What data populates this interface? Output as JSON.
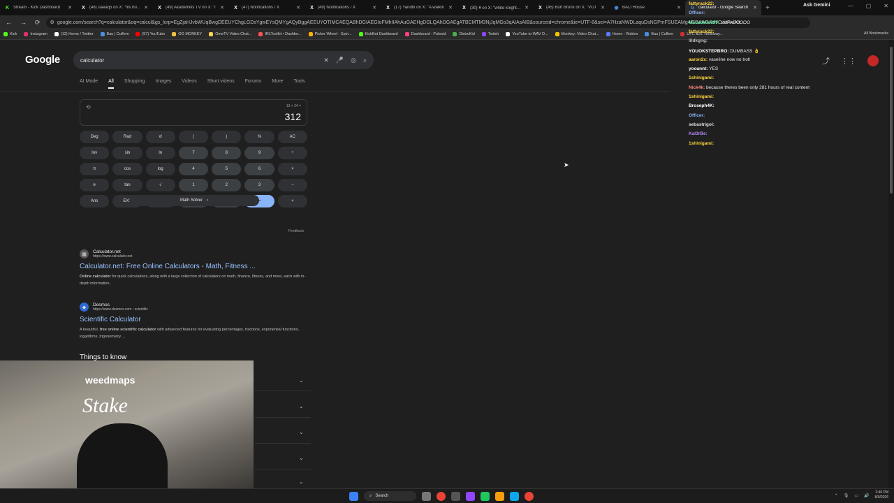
{
  "browser": {
    "tabs": [
      {
        "title": "Stream - Kick Dashboard",
        "color": "#53fc18",
        "icon": "kick-icon",
        "glyph": "K"
      },
      {
        "title": "(48) uaeaq5 on X: \"his burne",
        "color": "#ffffff",
        "icon": "x-icon",
        "glyph": "X"
      },
      {
        "title": "(49) Akademiks TV on X: \"I",
        "color": "#ffffff",
        "icon": "x-icon",
        "glyph": "X"
      },
      {
        "title": "(47) Notifications / X",
        "color": "#ffffff",
        "icon": "x-icon",
        "glyph": "X"
      },
      {
        "title": "(49) Notifications / X",
        "color": "#ffffff",
        "icon": "x-icon",
        "glyph": "X"
      },
      {
        "title": "(17) Yandhi on X: \"A walkin",
        "color": "#ffffff",
        "icon": "x-icon",
        "glyph": "X"
      },
      {
        "title": "(30) ¥ on X: \"white knight 💀",
        "color": "#ffffff",
        "icon": "x-icon",
        "glyph": "X"
      },
      {
        "title": "(45) Burt Bronx on X: \"VOT",
        "color": "#ffffff",
        "icon": "x-icon",
        "glyph": "X"
      },
      {
        "title": "BALI House",
        "color": "#4a90e2",
        "icon": "globe-icon",
        "glyph": "◉"
      },
      {
        "title": "calculator - Google Search",
        "color": "#4285f4",
        "icon": "google-icon",
        "glyph": "G",
        "active": true
      }
    ],
    "ask_gemini": "Ask Gemini",
    "url": "google.com/search?q=calculator&oq=calcul&gs_lcrp=EgZjaHJvbWUqBwgDEEUYChgLGDsYgwEYsQMYgAQyBggAEEUYOTIMCAEQABhDGIAEGIoFMhIIAhAuGAEHgDGLQAhDGAEgATBCMTM3NjJqMGo3qAIAsAIB&sourceid=chrome&ie=UTF-8&sei=A7HzaNWDLaquDsNGPmFSUEAMg4lCBAAGAoYCxixAxiAIt...",
    "bookmarks": [
      {
        "label": "Kick",
        "color": "#53fc18"
      },
      {
        "label": "Instagram",
        "color": "#e1306c"
      },
      {
        "label": "(12) Home / Twitter",
        "color": "#ffffff"
      },
      {
        "label": "Bau | Cuffem",
        "color": "#4a90e2"
      },
      {
        "label": "(57) YouTube",
        "color": "#ff0000"
      },
      {
        "label": "OG MONKEY",
        "color": "#f0c040"
      },
      {
        "label": "OmeTV Video Chat...",
        "color": "#ffd54f"
      },
      {
        "label": "IRLToolkit • Dashbo...",
        "color": "#ff5252"
      },
      {
        "label": "Picker Wheel - Spin...",
        "color": "#ffb300"
      },
      {
        "label": "KickBot Dashboard",
        "color": "#53fc18"
      },
      {
        "label": "Dashboard - Pulsoid",
        "color": "#ff4081"
      },
      {
        "label": "DistroKid",
        "color": "#4caf50"
      },
      {
        "label": "Twitch",
        "color": "#9146ff"
      },
      {
        "label": "YouTube to WAV D...",
        "color": "#ffffff"
      },
      {
        "label": "Monkey: Video Chat...",
        "color": "#f5c400"
      },
      {
        "label": "Home - Roblox",
        "color": "#5b7bf7"
      },
      {
        "label": "Bau | Cuffem",
        "color": "#4a90e2"
      },
      {
        "label": "UFC 326: Holloway...",
        "color": "#d32f2f"
      }
    ],
    "all_bookmarks": "All Bookmarks"
  },
  "google": {
    "logo": "Google",
    "query": "calculator",
    "tabs": [
      "AI Mode",
      "All",
      "Shopping",
      "Images",
      "Videos",
      "Short videos",
      "Forums",
      "More",
      "Tools"
    ],
    "active_tab": "All",
    "calculator": {
      "expression": "13 × 24 =",
      "result": "312",
      "keys": [
        {
          "l": "Deg",
          "t": "fn"
        },
        {
          "l": "Rad",
          "t": "fn"
        },
        {
          "l": "x!",
          "t": "fn"
        },
        {
          "l": "(",
          "t": "fn"
        },
        {
          "l": ")",
          "t": "fn"
        },
        {
          "l": "%",
          "t": "fn"
        },
        {
          "l": "AC",
          "t": "fn"
        },
        {
          "l": "Inv",
          "t": "fn"
        },
        {
          "l": "sin",
          "t": "fn"
        },
        {
          "l": "ln",
          "t": "fn"
        },
        {
          "l": "7",
          "t": "num"
        },
        {
          "l": "8",
          "t": "num"
        },
        {
          "l": "9",
          "t": "num"
        },
        {
          "l": "÷",
          "t": "fn"
        },
        {
          "l": "π",
          "t": "fn"
        },
        {
          "l": "cos",
          "t": "fn"
        },
        {
          "l": "log",
          "t": "fn"
        },
        {
          "l": "4",
          "t": "num"
        },
        {
          "l": "5",
          "t": "num"
        },
        {
          "l": "6",
          "t": "num"
        },
        {
          "l": "×",
          "t": "fn"
        },
        {
          "l": "e",
          "t": "fn"
        },
        {
          "l": "tan",
          "t": "fn"
        },
        {
          "l": "√",
          "t": "fn"
        },
        {
          "l": "1",
          "t": "num"
        },
        {
          "l": "2",
          "t": "num"
        },
        {
          "l": "3",
          "t": "num"
        },
        {
          "l": "−",
          "t": "fn"
        },
        {
          "l": "Ans",
          "t": "fn"
        },
        {
          "l": "EXP",
          "t": "fn"
        },
        {
          "l": "xʸ",
          "t": "fn"
        },
        {
          "l": "0",
          "t": "num"
        },
        {
          "l": ".",
          "t": "num"
        },
        {
          "l": "=",
          "t": "eq"
        },
        {
          "l": "+",
          "t": "fn"
        }
      ],
      "math_solver": "Math Solver",
      "feedback": "Feedback"
    },
    "results": [
      {
        "site": "Calculator.net",
        "url": "https://www.calculator.net",
        "title": "Calculator.net: Free Online Calculators - Math, Fitness ...",
        "snippet_bold": "Online calculator",
        "snippet": " for quick calculations, along with a large collection of calculators on math, finance, fitness, and more, each with in-depth information."
      },
      {
        "site": "Desmos",
        "url": "https://www.desmos.com › scientific",
        "title": "Scientific Calculator",
        "snippet_pre": "A beautiful, ",
        "snippet_bold": "free online scientific calculator",
        "snippet": " with advanced features for evaluating percentages, fractions, exponential functions, logarithms, trigonometry ..."
      }
    ],
    "things_to_know": "Things to know"
  },
  "chat": [
    {
      "user": "fattyrack22:",
      "msg": "",
      "color": "#ffd740"
    },
    {
      "user": "Officer:",
      "msg": "",
      "color": "#8ab4f8"
    },
    {
      "user": "Macadelic999:",
      "msg": "LMFAOOOOO",
      "color": "#69f0ae"
    },
    {
      "user": "fattyrack22:",
      "msg": "",
      "color": "#ffd740"
    },
    {
      "user": "lildkgng:",
      "msg": "",
      "color": "#bdbdbd"
    },
    {
      "user": "YOUOKSTEPBRO:",
      "msg": "DUMBASS 👌",
      "color": "#ffffff"
    },
    {
      "user": "aaron2x:",
      "msg": "vaseline now no troll",
      "color": "#ffd740"
    },
    {
      "user": "yooannt:",
      "msg": "YES",
      "color": "#ffffff"
    },
    {
      "user": "1shinigami:",
      "msg": "",
      "color": "#ffd740"
    },
    {
      "user": "Nick4k:",
      "msg": "because theres been only 281 hours of real content",
      "color": "#ff8a80"
    },
    {
      "user": "1shinigami:",
      "msg": "",
      "color": "#ffd740"
    },
    {
      "user": "Broseph4K:",
      "msg": "",
      "color": "#ffffff"
    },
    {
      "user": "Officer:",
      "msg": "",
      "color": "#8ab4f8"
    },
    {
      "user": "sebastrigol:",
      "msg": "",
      "color": "#e0e0e0"
    },
    {
      "user": "Kal3rBe:",
      "msg": "",
      "color": "#b388ff"
    },
    {
      "user": "1shinigami:",
      "msg": "",
      "color": "#ffd740"
    }
  ],
  "webcam": {
    "brand": "weedmaps",
    "sign": "Stake"
  },
  "taskbar": {
    "search": "Search",
    "time": "2:40 PM",
    "date": "8/9/2026"
  }
}
